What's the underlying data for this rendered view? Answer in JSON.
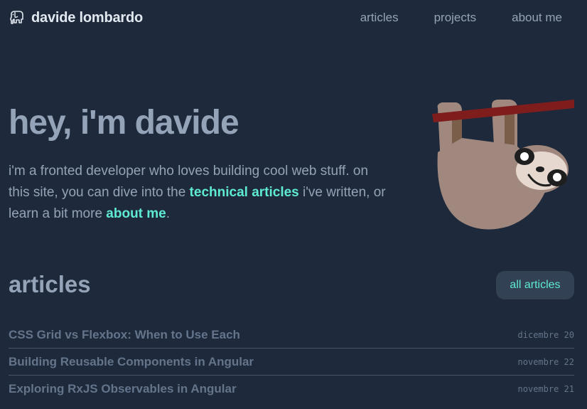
{
  "header": {
    "logo_icon": "elephant-icon",
    "site_title": "davide lombardo",
    "nav": [
      "articles",
      "projects",
      "about me"
    ]
  },
  "hero": {
    "title": "hey, i'm davide",
    "text_part1": "i'm a fronted developer who loves building cool web stuff. on this site, you can dive into the ",
    "link1": "technical articles",
    "text_part2": " i've written, or learn a bit more ",
    "link2": "about me",
    "text_part3": ".",
    "illustration": "sloth-hanging-illustration"
  },
  "articles": {
    "section_title": "articles",
    "all_button": "all articles",
    "items": [
      {
        "title": "CSS Grid vs Flexbox: When to Use Each",
        "date": "dicembre 20"
      },
      {
        "title": "Building Reusable Components in Angular",
        "date": "novembre 22"
      },
      {
        "title": "Exploring RxJS Observables in Angular",
        "date": "novembre 21"
      }
    ]
  },
  "colors": {
    "background": "#1e293b",
    "accent": "#5eead4",
    "text": "#94a3b8",
    "button_bg": "#334155"
  }
}
